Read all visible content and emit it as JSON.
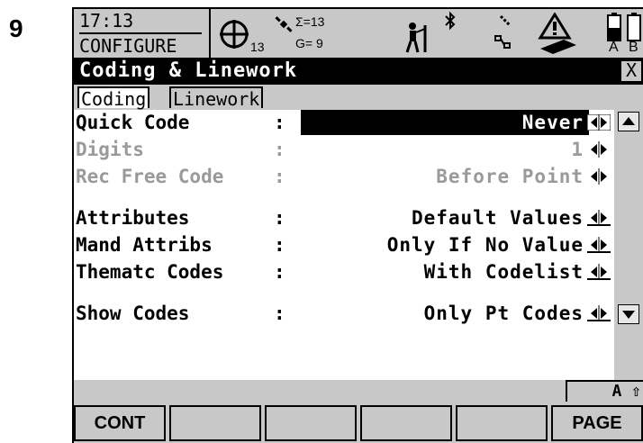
{
  "step_number": "9",
  "status": {
    "time": "17:13",
    "mode": "CONFIGURE",
    "satellites_count": "13",
    "sum_label": "Σ=13",
    "g_label": "G= 9",
    "battery_labels": [
      "A",
      "B"
    ]
  },
  "title": "Coding & Linework",
  "close_label": "X",
  "tabs": [
    {
      "label": "Coding",
      "active": true
    },
    {
      "label": "Linework",
      "active": false
    }
  ],
  "fields": [
    {
      "label": "Quick Code",
      "value": "Never",
      "state": "highlight"
    },
    {
      "label": "Digits",
      "value": "1",
      "state": "disabled"
    },
    {
      "label": "Rec Free Code",
      "value": "Before Point",
      "state": "disabled"
    },
    {
      "label": "Attributes",
      "value": "Default Values",
      "state": "normal"
    },
    {
      "label": "Mand Attribs",
      "value": "Only If No Value",
      "state": "normal"
    },
    {
      "label": "Thematc Codes",
      "value": "With Codelist",
      "state": "normal"
    },
    {
      "label": "Show Codes",
      "value": "Only Pt Codes",
      "state": "normal"
    }
  ],
  "keyboard_mode": "A ⇧",
  "function_keys": [
    "CONT",
    "",
    "",
    "",
    "",
    "PAGE"
  ]
}
